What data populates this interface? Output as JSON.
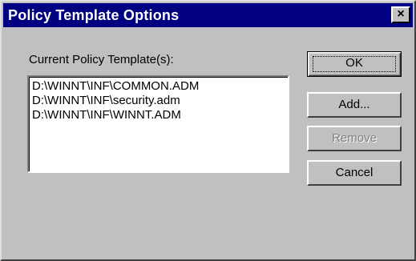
{
  "window": {
    "title": "Policy Template Options",
    "close_symbol": "×"
  },
  "templates": {
    "label": "Current Policy Template(s):",
    "items": [
      "D:\\WINNT\\INF\\COMMON.ADM",
      "D:\\WINNT\\INF\\security.adm",
      "D:\\WINNT\\INF\\WINNT.ADM"
    ]
  },
  "buttons": {
    "ok": "OK",
    "add": "Add...",
    "remove": "Remove",
    "cancel": "Cancel"
  },
  "colors": {
    "titlebar": "#000080",
    "face": "#c0c0c0",
    "disabled_text": "#808080"
  },
  "icons": {
    "close": "close-icon"
  }
}
